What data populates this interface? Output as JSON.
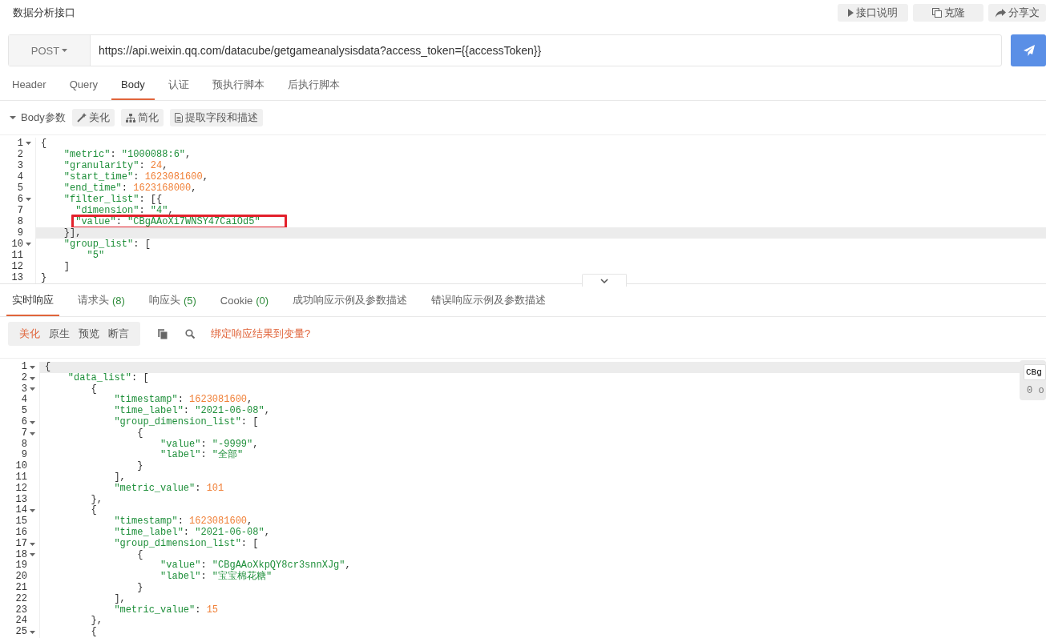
{
  "title": "数据分析接口",
  "header_buttons": [
    {
      "kind": "play",
      "label": "接口说明"
    },
    {
      "kind": "copy",
      "label": "克隆"
    },
    {
      "kind": "share",
      "label": "分享文"
    }
  ],
  "request": {
    "method": "POST",
    "url": "https://api.weixin.qq.com/datacube/getgameanalysisdata?access_token={{accessToken}}"
  },
  "request_tabs": [
    {
      "label": "Header",
      "selected": false
    },
    {
      "label": "Query",
      "selected": false
    },
    {
      "label": "Body",
      "selected": true
    },
    {
      "label": "认证",
      "selected": false
    },
    {
      "label": "预执行脚本",
      "selected": false
    },
    {
      "label": "后执行脚本",
      "selected": false
    }
  ],
  "body_toolbar": {
    "label": "Body参数",
    "expanded": true,
    "buttons": [
      {
        "kind": "wand",
        "label": "美化"
      },
      {
        "kind": "sitemap",
        "label": "简化"
      },
      {
        "kind": "document",
        "label": "提取字段和描述"
      }
    ]
  },
  "request_body": {
    "lines": [
      {
        "number": "1",
        "text": "{",
        "foldable": true,
        "active": false,
        "marked": false
      },
      {
        "number": "2",
        "text": "    \"metric\": \"1000088:6\",",
        "foldable": false,
        "active": false,
        "marked": false
      },
      {
        "number": "3",
        "text": "    \"granularity\": 24,",
        "foldable": false,
        "active": false,
        "marked": false
      },
      {
        "number": "4",
        "text": "    \"start_time\": 1623081600,",
        "foldable": false,
        "active": false,
        "marked": false
      },
      {
        "number": "5",
        "text": "    \"end_time\": 1623168000,",
        "foldable": false,
        "active": false,
        "marked": false
      },
      {
        "number": "6",
        "text": "    \"filter_list\": [{",
        "foldable": true,
        "active": false,
        "marked": false
      },
      {
        "number": "7",
        "text": "      \"dimension\": \"4\",",
        "foldable": false,
        "active": false,
        "marked": false
      },
      {
        "number": "8",
        "text": "      \"value\": \"CBgAAoXi7WNSY47CaiOd5\"",
        "foldable": false,
        "active": false,
        "marked": true
      },
      {
        "number": "9",
        "text": "    }],",
        "foldable": false,
        "active": true,
        "marked": false
      },
      {
        "number": "10",
        "text": "    \"group_list\": [",
        "foldable": true,
        "active": false,
        "marked": false
      },
      {
        "number": "11",
        "text": "        \"5\"",
        "foldable": false,
        "active": false,
        "marked": false
      },
      {
        "number": "12",
        "text": "    ]",
        "foldable": false,
        "active": false,
        "marked": false
      },
      {
        "number": "13",
        "text": "}",
        "foldable": false,
        "active": false,
        "marked": false
      }
    ]
  },
  "response_tabs": [
    {
      "label": "实时响应",
      "selected": true
    },
    {
      "label": "请求头",
      "count": "(8)",
      "selected": false
    },
    {
      "label": "响应头",
      "count": "(5)",
      "selected": false
    },
    {
      "label": "Cookie",
      "count": "(0)",
      "selected": false
    },
    {
      "label": "成功响应示例及参数描述",
      "selected": false
    },
    {
      "label": "错误响应示例及参数描述",
      "selected": false
    }
  ],
  "view_modes": [
    {
      "label": "美化",
      "selected": true
    },
    {
      "label": "原生",
      "selected": false
    },
    {
      "label": "预览",
      "selected": false
    },
    {
      "label": "断言",
      "selected": false
    }
  ],
  "bind_link": "绑定响应结果到变量?",
  "response_body": {
    "lines": [
      {
        "number": "1",
        "text": "{",
        "foldable": true,
        "active": true,
        "marked": false
      },
      {
        "number": "2",
        "text": "    \"data_list\": [",
        "foldable": true,
        "active": false,
        "marked": false
      },
      {
        "number": "3",
        "text": "        {",
        "foldable": true,
        "active": false,
        "marked": false
      },
      {
        "number": "4",
        "text": "            \"timestamp\": 1623081600,",
        "foldable": false,
        "active": false,
        "marked": false
      },
      {
        "number": "5",
        "text": "            \"time_label\": \"2021-06-08\",",
        "foldable": false,
        "active": false,
        "marked": false
      },
      {
        "number": "6",
        "text": "            \"group_dimension_list\": [",
        "foldable": true,
        "active": false,
        "marked": false
      },
      {
        "number": "7",
        "text": "                {",
        "foldable": true,
        "active": false,
        "marked": false
      },
      {
        "number": "8",
        "text": "                    \"value\": \"-9999\",",
        "foldable": false,
        "active": false,
        "marked": false
      },
      {
        "number": "9",
        "text": "                    \"label\": \"全部\"",
        "foldable": false,
        "active": false,
        "marked": false
      },
      {
        "number": "10",
        "text": "                }",
        "foldable": false,
        "active": false,
        "marked": false
      },
      {
        "number": "11",
        "text": "            ],",
        "foldable": false,
        "active": false,
        "marked": false
      },
      {
        "number": "12",
        "text": "            \"metric_value\": 101",
        "foldable": false,
        "active": false,
        "marked": false
      },
      {
        "number": "13",
        "text": "        },",
        "foldable": false,
        "active": false,
        "marked": false
      },
      {
        "number": "14",
        "text": "        {",
        "foldable": true,
        "active": false,
        "marked": false
      },
      {
        "number": "15",
        "text": "            \"timestamp\": 1623081600,",
        "foldable": false,
        "active": false,
        "marked": false
      },
      {
        "number": "16",
        "text": "            \"time_label\": \"2021-06-08\",",
        "foldable": false,
        "active": false,
        "marked": false
      },
      {
        "number": "17",
        "text": "            \"group_dimension_list\": [",
        "foldable": true,
        "active": false,
        "marked": false
      },
      {
        "number": "18",
        "text": "                {",
        "foldable": true,
        "active": false,
        "marked": false
      },
      {
        "number": "19",
        "text": "                    \"value\": \"CBgAAoXkpQY8cr3snnXJg\",",
        "foldable": false,
        "active": false,
        "marked": false
      },
      {
        "number": "20",
        "text": "                    \"label\": \"宝宝棉花糖\"",
        "foldable": false,
        "active": false,
        "marked": false
      },
      {
        "number": "21",
        "text": "                }",
        "foldable": false,
        "active": false,
        "marked": false
      },
      {
        "number": "22",
        "text": "            ],",
        "foldable": false,
        "active": false,
        "marked": false
      },
      {
        "number": "23",
        "text": "            \"metric_value\": 15",
        "foldable": false,
        "active": false,
        "marked": false
      },
      {
        "number": "24",
        "text": "        },",
        "foldable": false,
        "active": false,
        "marked": false
      },
      {
        "number": "25",
        "text": "        {",
        "foldable": true,
        "active": false,
        "marked": false
      }
    ]
  },
  "search_popup": {
    "value": "CBg",
    "count": "0 o"
  }
}
